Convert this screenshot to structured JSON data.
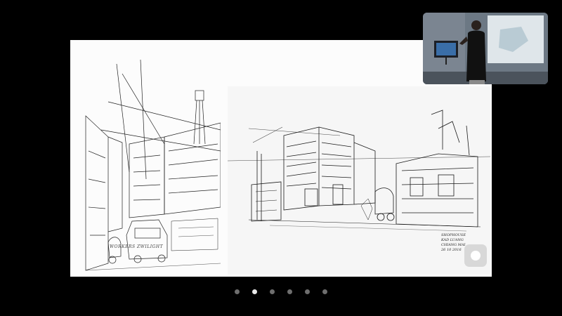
{
  "slide": {
    "left_caption": "WORKERS ZWILIGHT",
    "right_caption_lines": [
      "SHOPHOUSE",
      "KAD LUANG",
      "CHIANG MAI",
      "26 10 2016"
    ]
  },
  "presenter_video": {
    "screen_label": ""
  },
  "pagination": {
    "dots": [
      "1",
      "2",
      "3",
      "4",
      "5",
      "6"
    ],
    "active_index": 1
  },
  "colors": {
    "background": "#000000",
    "slide": "#fcfcfc",
    "active_dot": "#e9e9e9",
    "inactive_dot": "#6e6e6e"
  }
}
